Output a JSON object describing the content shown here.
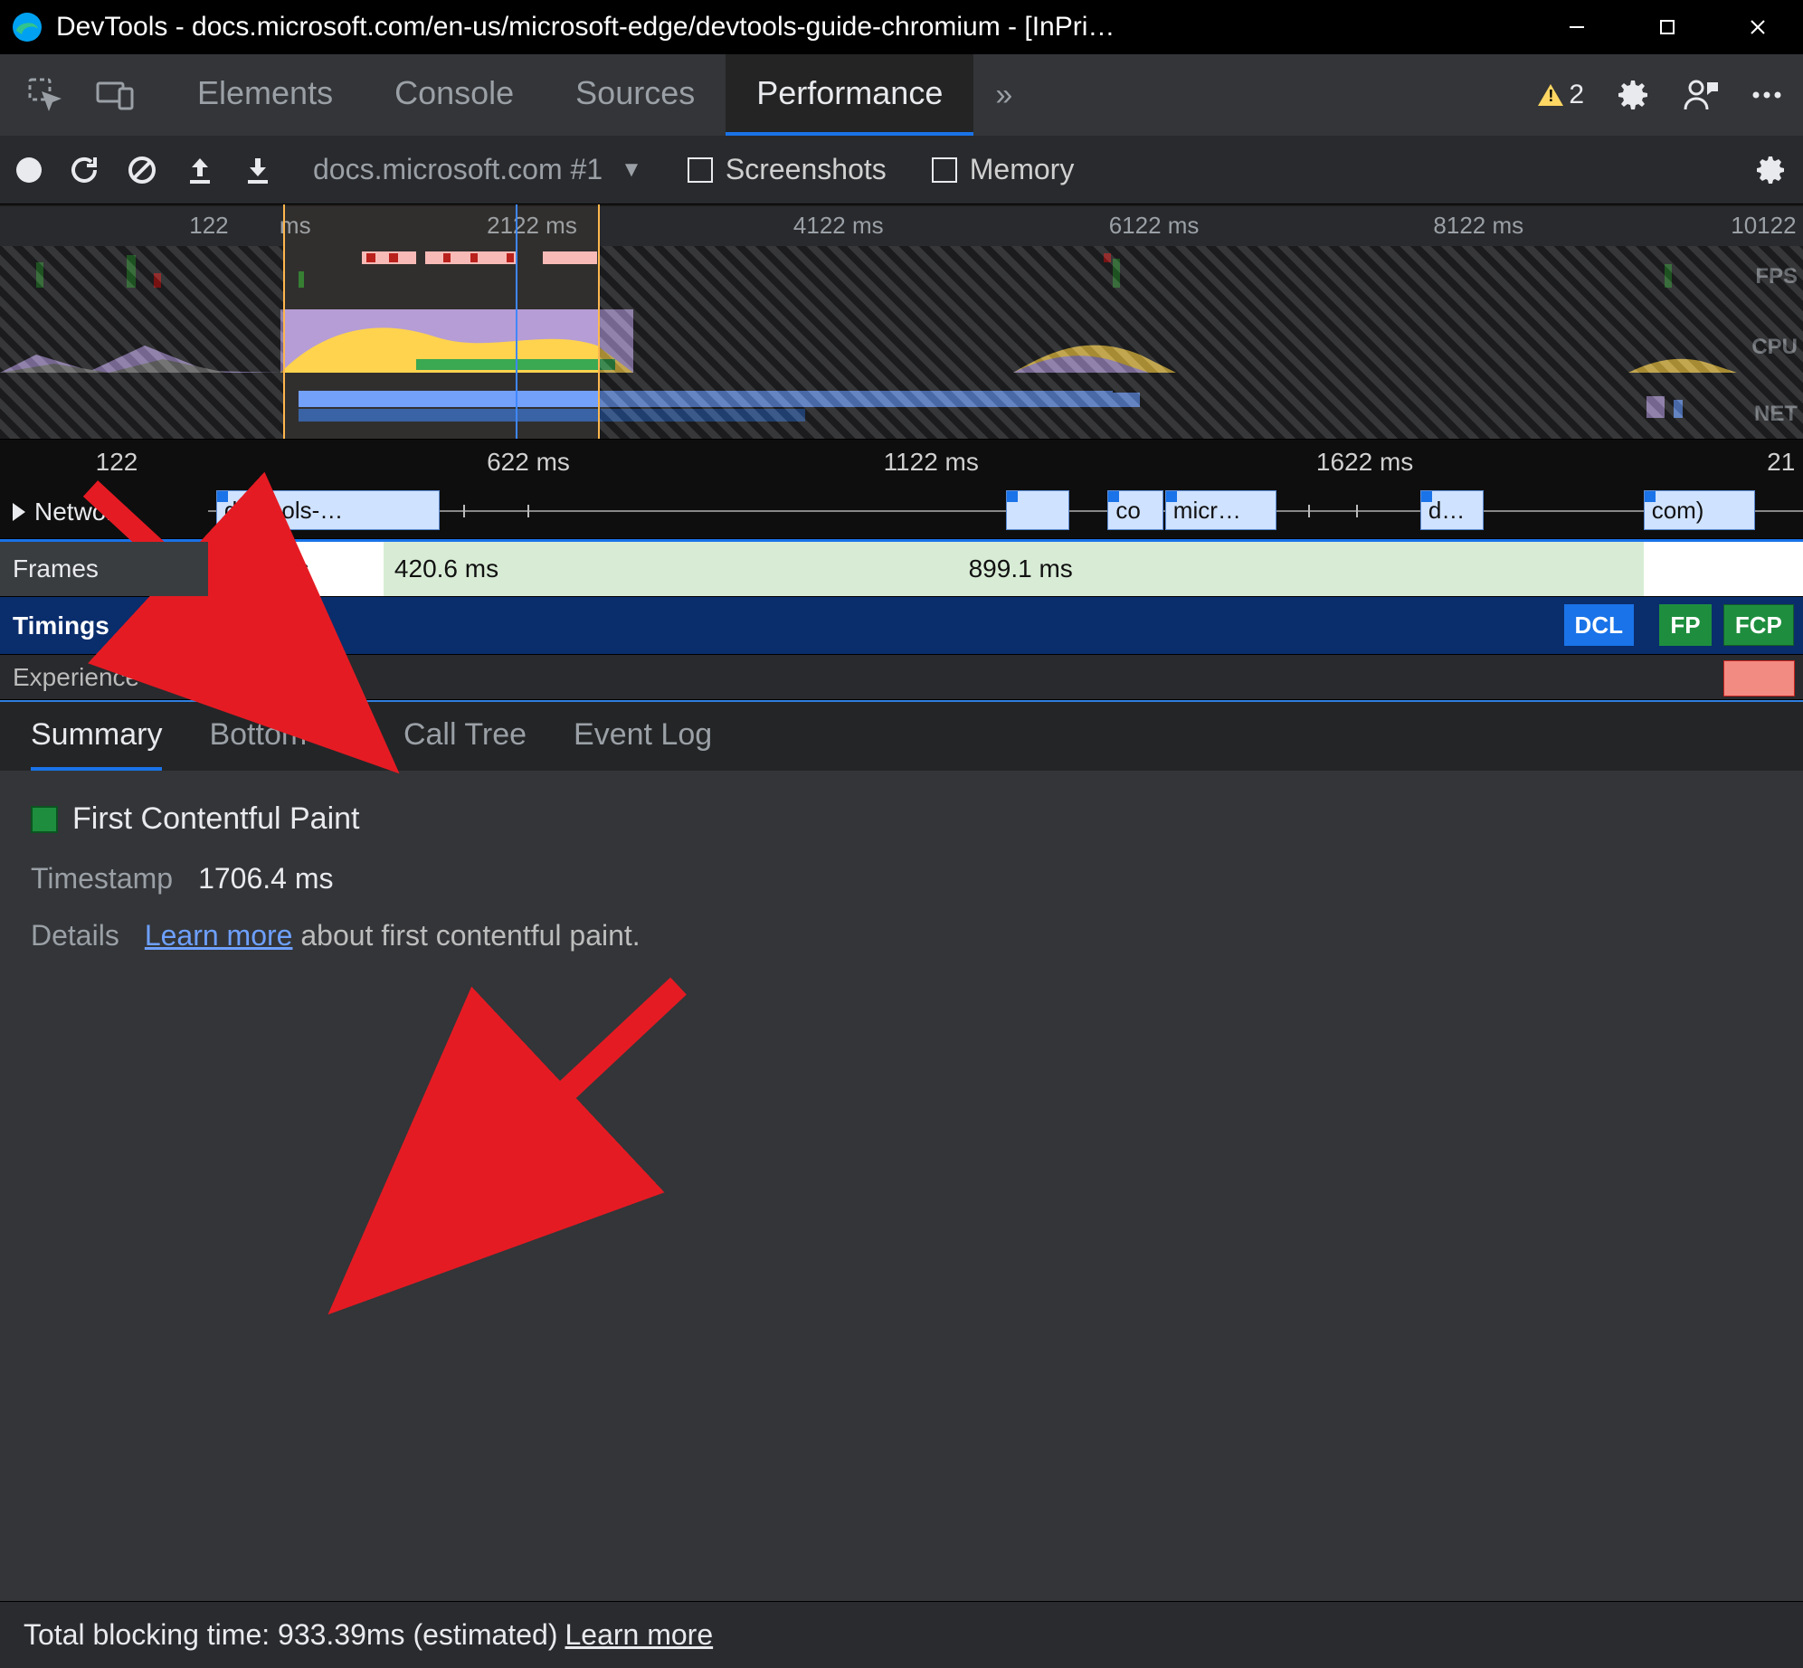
{
  "titlebar": {
    "title": "DevTools - docs.microsoft.com/en-us/microsoft-edge/devtools-guide-chromium - [InPri…"
  },
  "main_tabs": {
    "items": [
      "Elements",
      "Console",
      "Sources",
      "Performance"
    ],
    "active_index": 3,
    "overflow_glyph": "»",
    "warnings_count": "2"
  },
  "perf_toolbar": {
    "session_label": "docs.microsoft.com #1",
    "screenshots_label": "Screenshots",
    "memory_label": "Memory"
  },
  "overview_ruler": {
    "ticks": [
      {
        "label": "122",
        "left_pct": 10.5
      },
      {
        "label": "ms",
        "left_pct": 15.5
      },
      {
        "label": "2122 ms",
        "left_pct": 27
      },
      {
        "label": "4122 ms",
        "left_pct": 44
      },
      {
        "label": "6122 ms",
        "left_pct": 61.5
      },
      {
        "label": "8122 ms",
        "left_pct": 79.5
      },
      {
        "label": "10122",
        "left_pct": 96
      }
    ],
    "labels": {
      "fps": "FPS",
      "cpu": "CPU",
      "net": "NET"
    }
  },
  "detail_ruler": {
    "ticks": [
      {
        "label": "122",
        "left_pct": 5.3
      },
      {
        "label": "622 ms",
        "left_pct": 27
      },
      {
        "label": "1122 ms",
        "left_pct": 49
      },
      {
        "label": "1622 ms",
        "left_pct": 73
      },
      {
        "label": "21",
        "left_pct": 98
      }
    ]
  },
  "rows": {
    "network_label": "Network",
    "frames_label": "Frames",
    "timings_label": "Timings",
    "experience_label": "Experience",
    "network_blocks": [
      {
        "label": "devtools-…",
        "left_pct": 0.5,
        "width_pct": 14
      },
      {
        "label": "",
        "left_pct": 50,
        "width_pct": 4
      },
      {
        "label": "co",
        "left_pct": 56.4,
        "width_pct": 3.5
      },
      {
        "label": "micr…",
        "left_pct": 60,
        "width_pct": 7
      },
      {
        "label": "d…",
        "left_pct": 76,
        "width_pct": 4
      },
      {
        "label": "com)",
        "left_pct": 90,
        "width_pct": 7
      }
    ],
    "frames_segments": [
      {
        "label": "57.0 ms",
        "left_pct": 0,
        "width_pct": 11,
        "class": "white"
      },
      {
        "label": "420.6 ms",
        "left_pct": 11,
        "width_pct": 36,
        "class": "green"
      },
      {
        "label": "899.1 ms",
        "left_pct": 47,
        "width_pct": 43,
        "class": "green"
      },
      {
        "label": "",
        "left_pct": 90,
        "width_pct": 10,
        "class": "white"
      }
    ],
    "timings_pills": [
      {
        "label": "DCL",
        "class": "dcl",
        "left_pct": 85
      },
      {
        "label": "FP",
        "class": "fp",
        "left_pct": 91
      },
      {
        "label": "FCP",
        "class": "fcp",
        "left_pct": 95
      }
    ],
    "experience_block_label": ""
  },
  "bottom_tabs": {
    "items": [
      "Summary",
      "Bottom-Up",
      "Call Tree",
      "Event Log"
    ],
    "active_index": 0
  },
  "summary": {
    "entry_name": "First Contentful Paint",
    "timestamp_label": "Timestamp",
    "timestamp_value": "1706.4 ms",
    "details_label": "Details",
    "learn_more": "Learn more",
    "details_rest": " about first contentful paint."
  },
  "footer": {
    "blocking_text": "Total blocking time: 933.39ms (estimated)",
    "learn_more": "Learn more"
  }
}
